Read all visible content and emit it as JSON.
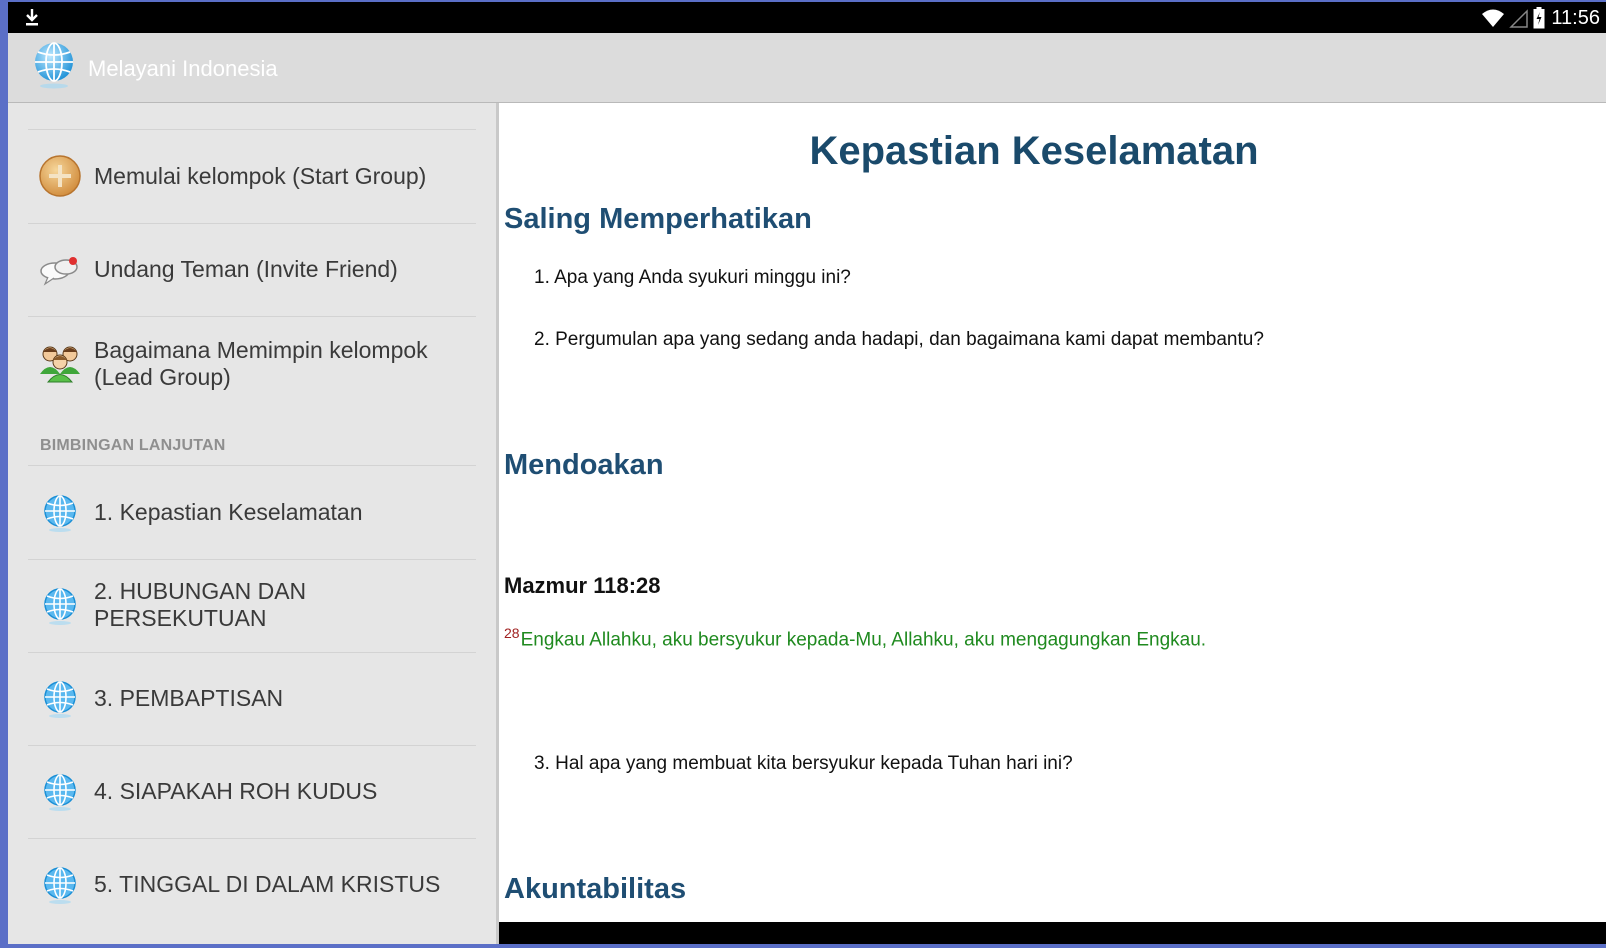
{
  "statusbar": {
    "time": "11:56"
  },
  "app": {
    "title": "Melayani Indonesia"
  },
  "drawer": {
    "items_top": [
      {
        "label": "Memulai kelompok (Start Group)",
        "icon": "plus-circle-icon"
      },
      {
        "label": "Undang Teman (Invite Friend)",
        "icon": "chat-bubbles-icon"
      },
      {
        "label": "Bagaimana Memimpin kelompok (Lead Group)",
        "icon": "people-group-icon"
      }
    ],
    "section_header": "BIMBINGAN LANJUTAN",
    "lessons": [
      {
        "label": "1. Kepastian Keselamatan",
        "icon": "globe-icon"
      },
      {
        "label": "2. HUBUNGAN DAN PERSEKUTUAN",
        "icon": "globe-icon"
      },
      {
        "label": "3. PEMBAPTISAN",
        "icon": "globe-icon"
      },
      {
        "label": "4. SIAPAKAH ROH KUDUS",
        "icon": "globe-icon"
      },
      {
        "label": "5. TINGGAL DI DALAM KRISTUS",
        "icon": "globe-icon"
      }
    ]
  },
  "content": {
    "title": "Kepastian Keselamatan",
    "section1": "Saling Memperhatikan",
    "q1": "1. Apa yang Anda syukuri minggu ini?",
    "q2": "2. Pergumulan apa yang sedang anda hadapi, dan bagaimana kami dapat membantu?",
    "section2": "Mendoakan",
    "reference": "Mazmur 118:28",
    "verse_number": "28",
    "verse_text": "Engkau Allahku, aku bersyukur kepada-Mu, Allahku, aku mengagungkan Engkau.",
    "q3": "3. Hal apa yang membuat kita bersyukur kepada Tuhan hari ini?",
    "section3": "Akuntabilitas"
  },
  "colors": {
    "heading": "#1f4e73",
    "verse": "#1f8a1f",
    "verse_number": "#a02020",
    "actionbar": "#dcdcdc",
    "drawer": "#e6e6e6"
  }
}
